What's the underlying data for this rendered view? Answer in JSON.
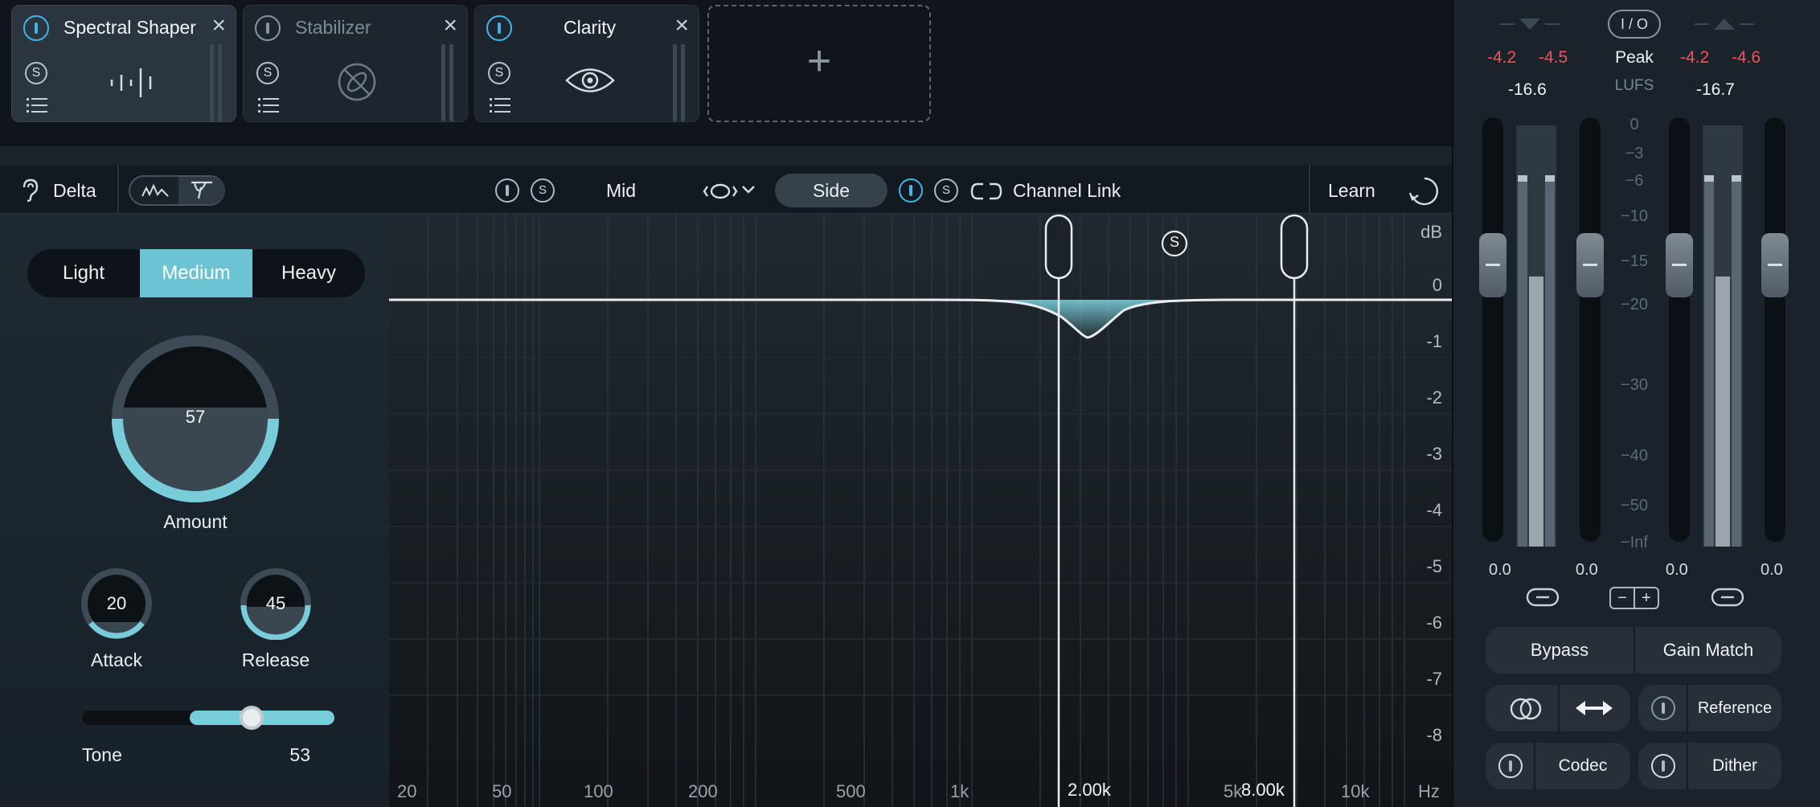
{
  "modules": [
    {
      "title": "Spectral Shaper",
      "active": true
    },
    {
      "title": "Stabilizer",
      "active": false
    },
    {
      "title": "Clarity",
      "active": true
    }
  ],
  "module_icons": {
    "solo": "S",
    "add": "+",
    "close": "×"
  },
  "toolbar": {
    "delta_label": "Delta",
    "mid_label": "Mid",
    "side_label": "Side",
    "channel_link_label": "Channel Link",
    "learn_label": "Learn",
    "solo_glyph": "S"
  },
  "modes": {
    "options": [
      "Light",
      "Medium",
      "Heavy"
    ],
    "selected": "Medium"
  },
  "controls": {
    "amount": {
      "label": "Amount",
      "value": "57",
      "fraction": 0.57
    },
    "attack": {
      "label": "Attack",
      "value": "20",
      "fraction": 0.2
    },
    "release": {
      "label": "Release",
      "value": "45",
      "fraction": 0.45
    },
    "tone": {
      "label": "Tone",
      "value": "53",
      "fraction": 0.53
    }
  },
  "graph": {
    "db_unit": "dB",
    "hz_unit": "Hz",
    "db_ticks": [
      "0",
      "-1",
      "-2",
      "-3",
      "-4",
      "-5",
      "-6",
      "-7",
      "-8"
    ],
    "freq_ticks": [
      "20",
      "50",
      "100",
      "200",
      "500",
      "1k",
      "5k",
      "10k"
    ],
    "band_low": "2.00k",
    "band_high": "8.00k",
    "solo_glyph": "S"
  },
  "meters": {
    "io_label": "I / O",
    "peak_label": "Peak",
    "lufs_label": "LUFS",
    "in_peak_left": "-4.2",
    "in_peak_right": "-4.5",
    "out_peak_left": "-4.2",
    "out_peak_right": "-4.6",
    "in_lufs": "-16.6",
    "out_lufs": "-16.7",
    "scale": [
      "0",
      "−3",
      "−6",
      "−10",
      "−15",
      "−20",
      "−30",
      "−40",
      "−50",
      "−Inf"
    ],
    "gain_in_left": "0.0",
    "gain_in_right": "0.0",
    "gain_out_left": "0.0",
    "gain_out_right": "0.0",
    "minus_glyph": "−",
    "plus_glyph": "+"
  },
  "buttons": {
    "bypass": "Bypass",
    "gain_match": "Gain Match",
    "reference": "Reference",
    "codec": "Codec",
    "dither": "Dither"
  },
  "colors": {
    "accent": "#3fb6e6",
    "teal": "#6cc3d2",
    "peak_red": "#f0525a"
  }
}
